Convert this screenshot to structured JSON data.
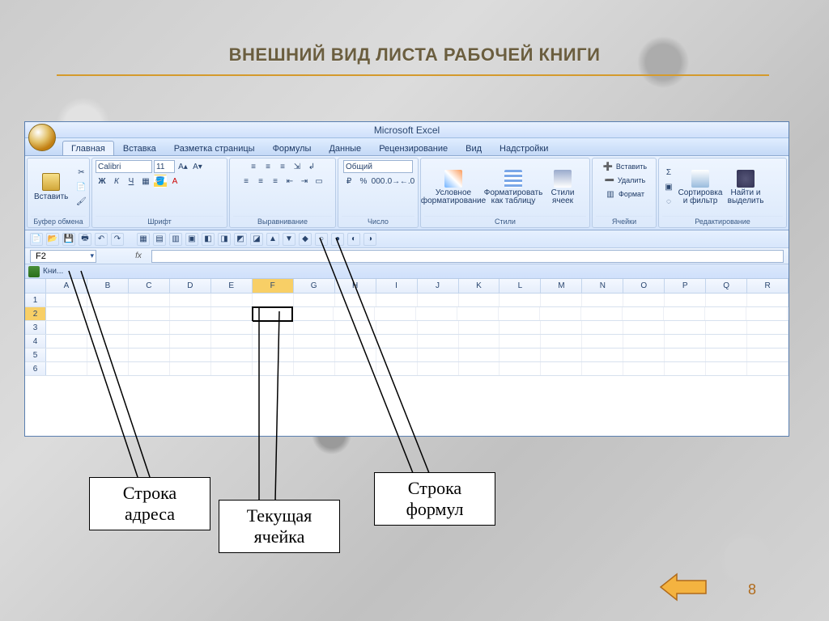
{
  "slide": {
    "title": "ВНЕШНИЙ ВИД ЛИСТА РАБОЧЕЙ КНИГИ",
    "page": "8"
  },
  "app": {
    "title": "Microsoft Excel"
  },
  "tabs": [
    "Главная",
    "Вставка",
    "Разметка страницы",
    "Формулы",
    "Данные",
    "Рецензирование",
    "Вид",
    "Надстройки"
  ],
  "clipboard": {
    "label": "Буфер обмена",
    "paste": "Вставить"
  },
  "font": {
    "label": "Шрифт",
    "name": "Calibri",
    "size": "11",
    "bold": "Ж",
    "italic": "К",
    "under": "Ч"
  },
  "align": {
    "label": "Выравнивание"
  },
  "number": {
    "label": "Число",
    "format": "Общий",
    "pct": "%",
    "sep": "000"
  },
  "styles": {
    "label": "Стили",
    "cond": "Условное форматирование",
    "table": "Форматировать как таблицу",
    "cell": "Стили ячеек"
  },
  "cells": {
    "label": "Ячейки",
    "ins": "Вставить",
    "del": "Удалить",
    "fmt": "Формат"
  },
  "edit": {
    "label": "Редактирование",
    "sort": "Сортировка и фильтр",
    "find": "Найти и выделить",
    "sigma": "Σ"
  },
  "namebox": {
    "value": "F2"
  },
  "workbook": {
    "tab": "Кни..."
  },
  "columns": [
    "A",
    "B",
    "C",
    "D",
    "E",
    "F",
    "G",
    "H",
    "I",
    "J",
    "K",
    "L",
    "M",
    "N",
    "O",
    "P",
    "Q",
    "R"
  ],
  "rows": [
    "1",
    "2",
    "3",
    "4",
    "5",
    "6"
  ],
  "active": {
    "col": "F",
    "row": "2"
  },
  "callouts": {
    "addr": "Строка адреса",
    "cell": "Текущая ячейка",
    "formula": "Строка формул"
  },
  "chart_data": null
}
